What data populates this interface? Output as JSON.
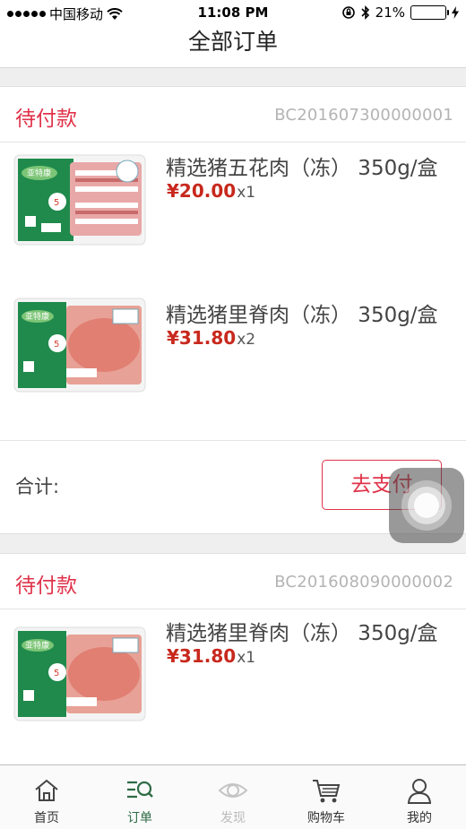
{
  "status_bar": {
    "carrier": "中国移动",
    "time": "11:08 PM",
    "battery": "21%",
    "battery_level": 0.21
  },
  "page_title": "全部订单",
  "orders": [
    {
      "status": "待付款",
      "order_no": "BC201607300000001",
      "items": [
        {
          "name": "精选猪五花肉（冻） 350g/盒",
          "price": "¥20.00",
          "qty": "x1"
        },
        {
          "name": "精选猪里脊肉（冻） 350g/盒",
          "price": "¥31.80",
          "qty": "x2"
        }
      ],
      "total_label": "合计:",
      "pay_label": "去支付"
    },
    {
      "status": "待付款",
      "order_no": "BC201608090000002",
      "items": [
        {
          "name": "精选猪里脊肉（冻） 350g/盒",
          "price": "¥31.80",
          "qty": "x1"
        }
      ]
    }
  ],
  "product_brand": "亚特康",
  "product_badge": "5",
  "tabs": [
    {
      "label": "首页",
      "icon": "home-icon",
      "state": "normal"
    },
    {
      "label": "订单",
      "icon": "order-search-icon",
      "state": "active"
    },
    {
      "label": "发现",
      "icon": "eye-icon",
      "state": "disabled"
    },
    {
      "label": "购物车",
      "icon": "cart-icon",
      "state": "normal"
    },
    {
      "label": "我的",
      "icon": "user-icon",
      "state": "normal"
    }
  ],
  "colors": {
    "accent": "#e0334a",
    "price": "#c8281d",
    "active_tab": "#2e6b45"
  }
}
